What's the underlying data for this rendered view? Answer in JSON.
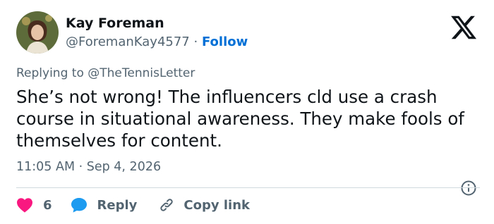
{
  "author": {
    "display_name": "Kay Foreman",
    "handle": "@ForemanKay4577",
    "separator": "·",
    "follow_label": "Follow"
  },
  "reply_to": {
    "prefix": "Replying to",
    "mention": "@TheTennisLetter"
  },
  "tweet": {
    "text": "She’s not wrong! The influencers cld use a crash course in situational awareness. They make fools of themselves for content.",
    "timestamp": "11:05 AM · Sep 4, 2026"
  },
  "actions": {
    "like_count": "6",
    "reply_label": "Reply",
    "copy_link_label": "Copy link"
  },
  "colors": {
    "accent": "#006fd6",
    "like": "#f91880",
    "reply": "#1d9bf0",
    "muted": "#536471"
  },
  "icons": [
    "x-logo-icon",
    "info-icon",
    "heart-icon",
    "reply-bubble-icon",
    "link-icon"
  ]
}
